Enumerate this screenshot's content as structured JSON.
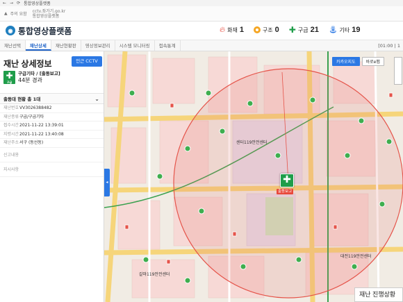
{
  "browser": {
    "tab_title": "통합영상플랫폼",
    "security_text": "주의 요함",
    "url_line1": "cctv.좌가기.go.kr",
    "url_line2": "통합영상플랫폼"
  },
  "header": {
    "app_name": "통합영상플랫폼",
    "stats": [
      {
        "icon": "fire-icon",
        "label": "화재",
        "count": "1",
        "color": "#e8483b"
      },
      {
        "icon": "lifebuoy-icon",
        "label": "구조",
        "count": "0",
        "color": "#f5a623"
      },
      {
        "icon": "cross-icon",
        "label": "구급",
        "count": "21",
        "color": "#1f9d4a"
      },
      {
        "icon": "faucet-icon",
        "label": "기타",
        "count": "19",
        "color": "#2b78e4"
      }
    ]
  },
  "tabs": [
    "재난선택",
    "재난상세",
    "재난현황판",
    "영상정보관리",
    "시스템 모니터링",
    "접속통계"
  ],
  "active_tab": "재난상세",
  "clock": "[01:00 | 1",
  "panel": {
    "title": "재난 상세정보",
    "cctv_button": "인근 CCTV",
    "incident_icon_text": "구급",
    "incident_type": "구급기타 / [출동보고]",
    "elapsed": "44분 경과",
    "dispatch_label": "출동대 현황 총 1대",
    "info": [
      {
        "key": "재난번호",
        "value": "VV3026388482"
      },
      {
        "key": "재난종류",
        "value": "구급/구급기타"
      },
      {
        "key": "접수시간",
        "value": "2021-11-22 13:39:01"
      },
      {
        "key": "지령시간",
        "value": "2021-11-22 13:40:08"
      },
      {
        "key": "재난주소",
        "value": "서구 (동선동)"
      },
      {
        "key": "신고내용",
        "value": ""
      },
      {
        "key": "지시사항",
        "value": ""
      }
    ]
  },
  "map": {
    "buttons": [
      "카카오지도",
      "바로e맵"
    ],
    "active_button": "카카오지도",
    "incident_label": "출동보고",
    "places": [
      "센터119안전센터",
      "대전119안전센터",
      "갈마119안전센터"
    ],
    "progress_label": "재난 진행상황"
  }
}
